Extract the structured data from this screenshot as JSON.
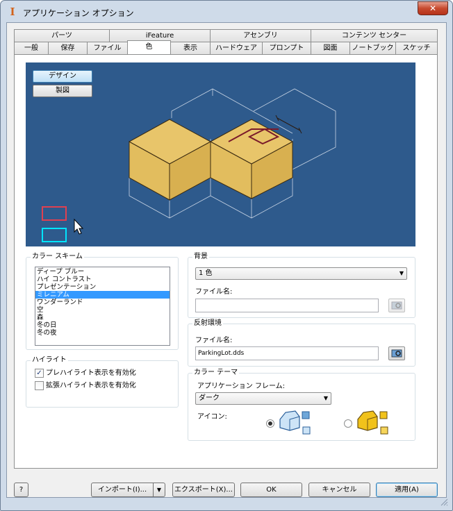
{
  "window": {
    "title": "アプリケーション オプション",
    "close_symbol": "✕",
    "app_icon_symbol": "I"
  },
  "tabs": {
    "row_top": [
      "パーツ",
      "iFeature",
      "アセンブリ",
      "コンテンツ センター"
    ],
    "row_bottom": [
      "一般",
      "保存",
      "ファイル",
      "色",
      "表示",
      "ハードウェア",
      "プロンプト",
      "図面",
      "ノートブック",
      "スケッチ"
    ],
    "active": "色"
  },
  "preview": {
    "design_button": "デザイン",
    "drawing_button": "製図",
    "accent_colors": {
      "background": "#2e5a8c",
      "part_fill": "#e5c061",
      "highlight": "#7a1a2a",
      "swatch_red": "#e04050",
      "swatch_cyan": "#00e5ff"
    }
  },
  "color_scheme": {
    "title": "カラー スキーム",
    "items": [
      "ディープ ブルー",
      "ハイ コントラスト",
      "プレゼンテーション",
      "ミレニアム",
      "ワンダーランド",
      "空",
      "森",
      "冬の日",
      "冬の夜"
    ],
    "selected": "ミレニアム"
  },
  "highlight": {
    "title": "ハイライト",
    "prehighlight_label": "プレハイライト表示を有効化",
    "prehighlight_checked": true,
    "enhanced_label": "拡張ハイライト表示を有効化",
    "enhanced_checked": false,
    "check_mark": "✓"
  },
  "background": {
    "title": "背景",
    "selected": "1 色",
    "file_label": "ファイル名:",
    "file_value": ""
  },
  "reflection": {
    "title": "反射環境",
    "file_label": "ファイル名:",
    "file_value": "ParkingLot.dds"
  },
  "color_theme": {
    "title": "カラー テーマ",
    "frame_label": "アプリケーション フレーム:",
    "frame_value": "ダーク",
    "icon_label": "アイコン:",
    "selected_icon_option": 1
  },
  "footer": {
    "help_symbol": "?",
    "import_label": "インポート(I)...",
    "export_label": "エクスポート(X)...",
    "ok_label": "OK",
    "cancel_label": "キャンセル",
    "apply_label": "適用(A)"
  }
}
